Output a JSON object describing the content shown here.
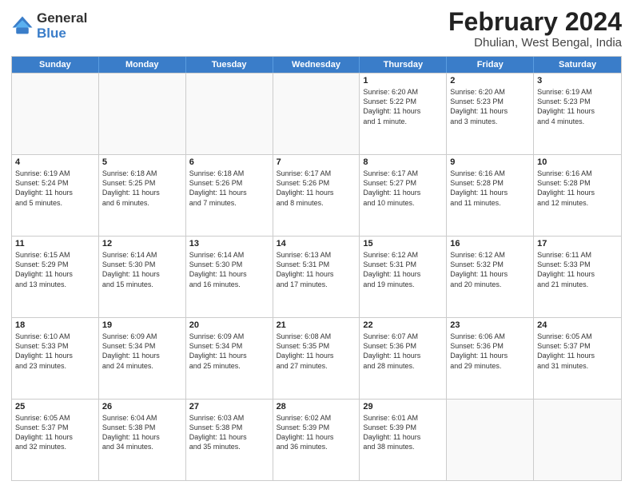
{
  "header": {
    "logo_line1": "General",
    "logo_line2": "Blue",
    "month": "February 2024",
    "location": "Dhulian, West Bengal, India"
  },
  "weekdays": [
    "Sunday",
    "Monday",
    "Tuesday",
    "Wednesday",
    "Thursday",
    "Friday",
    "Saturday"
  ],
  "rows": [
    [
      {
        "day": "",
        "lines": []
      },
      {
        "day": "",
        "lines": []
      },
      {
        "day": "",
        "lines": []
      },
      {
        "day": "",
        "lines": []
      },
      {
        "day": "1",
        "lines": [
          "Sunrise: 6:20 AM",
          "Sunset: 5:22 PM",
          "Daylight: 11 hours",
          "and 1 minute."
        ]
      },
      {
        "day": "2",
        "lines": [
          "Sunrise: 6:20 AM",
          "Sunset: 5:23 PM",
          "Daylight: 11 hours",
          "and 3 minutes."
        ]
      },
      {
        "day": "3",
        "lines": [
          "Sunrise: 6:19 AM",
          "Sunset: 5:23 PM",
          "Daylight: 11 hours",
          "and 4 minutes."
        ]
      }
    ],
    [
      {
        "day": "4",
        "lines": [
          "Sunrise: 6:19 AM",
          "Sunset: 5:24 PM",
          "Daylight: 11 hours",
          "and 5 minutes."
        ]
      },
      {
        "day": "5",
        "lines": [
          "Sunrise: 6:18 AM",
          "Sunset: 5:25 PM",
          "Daylight: 11 hours",
          "and 6 minutes."
        ]
      },
      {
        "day": "6",
        "lines": [
          "Sunrise: 6:18 AM",
          "Sunset: 5:26 PM",
          "Daylight: 11 hours",
          "and 7 minutes."
        ]
      },
      {
        "day": "7",
        "lines": [
          "Sunrise: 6:17 AM",
          "Sunset: 5:26 PM",
          "Daylight: 11 hours",
          "and 8 minutes."
        ]
      },
      {
        "day": "8",
        "lines": [
          "Sunrise: 6:17 AM",
          "Sunset: 5:27 PM",
          "Daylight: 11 hours",
          "and 10 minutes."
        ]
      },
      {
        "day": "9",
        "lines": [
          "Sunrise: 6:16 AM",
          "Sunset: 5:28 PM",
          "Daylight: 11 hours",
          "and 11 minutes."
        ]
      },
      {
        "day": "10",
        "lines": [
          "Sunrise: 6:16 AM",
          "Sunset: 5:28 PM",
          "Daylight: 11 hours",
          "and 12 minutes."
        ]
      }
    ],
    [
      {
        "day": "11",
        "lines": [
          "Sunrise: 6:15 AM",
          "Sunset: 5:29 PM",
          "Daylight: 11 hours",
          "and 13 minutes."
        ]
      },
      {
        "day": "12",
        "lines": [
          "Sunrise: 6:14 AM",
          "Sunset: 5:30 PM",
          "Daylight: 11 hours",
          "and 15 minutes."
        ]
      },
      {
        "day": "13",
        "lines": [
          "Sunrise: 6:14 AM",
          "Sunset: 5:30 PM",
          "Daylight: 11 hours",
          "and 16 minutes."
        ]
      },
      {
        "day": "14",
        "lines": [
          "Sunrise: 6:13 AM",
          "Sunset: 5:31 PM",
          "Daylight: 11 hours",
          "and 17 minutes."
        ]
      },
      {
        "day": "15",
        "lines": [
          "Sunrise: 6:12 AM",
          "Sunset: 5:31 PM",
          "Daylight: 11 hours",
          "and 19 minutes."
        ]
      },
      {
        "day": "16",
        "lines": [
          "Sunrise: 6:12 AM",
          "Sunset: 5:32 PM",
          "Daylight: 11 hours",
          "and 20 minutes."
        ]
      },
      {
        "day": "17",
        "lines": [
          "Sunrise: 6:11 AM",
          "Sunset: 5:33 PM",
          "Daylight: 11 hours",
          "and 21 minutes."
        ]
      }
    ],
    [
      {
        "day": "18",
        "lines": [
          "Sunrise: 6:10 AM",
          "Sunset: 5:33 PM",
          "Daylight: 11 hours",
          "and 23 minutes."
        ]
      },
      {
        "day": "19",
        "lines": [
          "Sunrise: 6:09 AM",
          "Sunset: 5:34 PM",
          "Daylight: 11 hours",
          "and 24 minutes."
        ]
      },
      {
        "day": "20",
        "lines": [
          "Sunrise: 6:09 AM",
          "Sunset: 5:34 PM",
          "Daylight: 11 hours",
          "and 25 minutes."
        ]
      },
      {
        "day": "21",
        "lines": [
          "Sunrise: 6:08 AM",
          "Sunset: 5:35 PM",
          "Daylight: 11 hours",
          "and 27 minutes."
        ]
      },
      {
        "day": "22",
        "lines": [
          "Sunrise: 6:07 AM",
          "Sunset: 5:36 PM",
          "Daylight: 11 hours",
          "and 28 minutes."
        ]
      },
      {
        "day": "23",
        "lines": [
          "Sunrise: 6:06 AM",
          "Sunset: 5:36 PM",
          "Daylight: 11 hours",
          "and 29 minutes."
        ]
      },
      {
        "day": "24",
        "lines": [
          "Sunrise: 6:05 AM",
          "Sunset: 5:37 PM",
          "Daylight: 11 hours",
          "and 31 minutes."
        ]
      }
    ],
    [
      {
        "day": "25",
        "lines": [
          "Sunrise: 6:05 AM",
          "Sunset: 5:37 PM",
          "Daylight: 11 hours",
          "and 32 minutes."
        ]
      },
      {
        "day": "26",
        "lines": [
          "Sunrise: 6:04 AM",
          "Sunset: 5:38 PM",
          "Daylight: 11 hours",
          "and 34 minutes."
        ]
      },
      {
        "day": "27",
        "lines": [
          "Sunrise: 6:03 AM",
          "Sunset: 5:38 PM",
          "Daylight: 11 hours",
          "and 35 minutes."
        ]
      },
      {
        "day": "28",
        "lines": [
          "Sunrise: 6:02 AM",
          "Sunset: 5:39 PM",
          "Daylight: 11 hours",
          "and 36 minutes."
        ]
      },
      {
        "day": "29",
        "lines": [
          "Sunrise: 6:01 AM",
          "Sunset: 5:39 PM",
          "Daylight: 11 hours",
          "and 38 minutes."
        ]
      },
      {
        "day": "",
        "lines": []
      },
      {
        "day": "",
        "lines": []
      }
    ]
  ]
}
